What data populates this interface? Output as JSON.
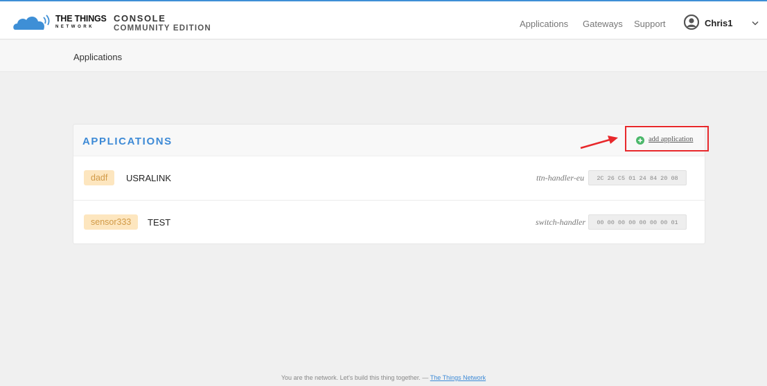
{
  "header": {
    "brand_line1": "THE THINGS",
    "brand_line2": "NETWORK",
    "console_line1": "CONSOLE",
    "console_line2": "COMMUNITY EDITION",
    "nav": {
      "applications": "Applications",
      "gateways": "Gateways",
      "support": "Support"
    },
    "user": "Chris1"
  },
  "breadcrumb": "Applications",
  "applications": {
    "title": "APPLICATIONS",
    "add_label": "add application",
    "items": [
      {
        "id": "dadf",
        "description": "USRALINK",
        "handler": "ttn-handler-eu",
        "eui": "2C 26 C5 01 24 84 20 08"
      },
      {
        "id": "sensor333",
        "description": "TEST",
        "handler": "switch-handler",
        "eui": "00 00 00 00 00 00 00 01"
      }
    ]
  },
  "footer": {
    "text": "You are the network. Let's build this thing together. — ",
    "link": "The Things Network"
  },
  "colors": {
    "accent": "#3d8ad6",
    "highlight": "#e8282b",
    "badge_bg": "#fde6bf",
    "badge_text": "#d19a47"
  }
}
